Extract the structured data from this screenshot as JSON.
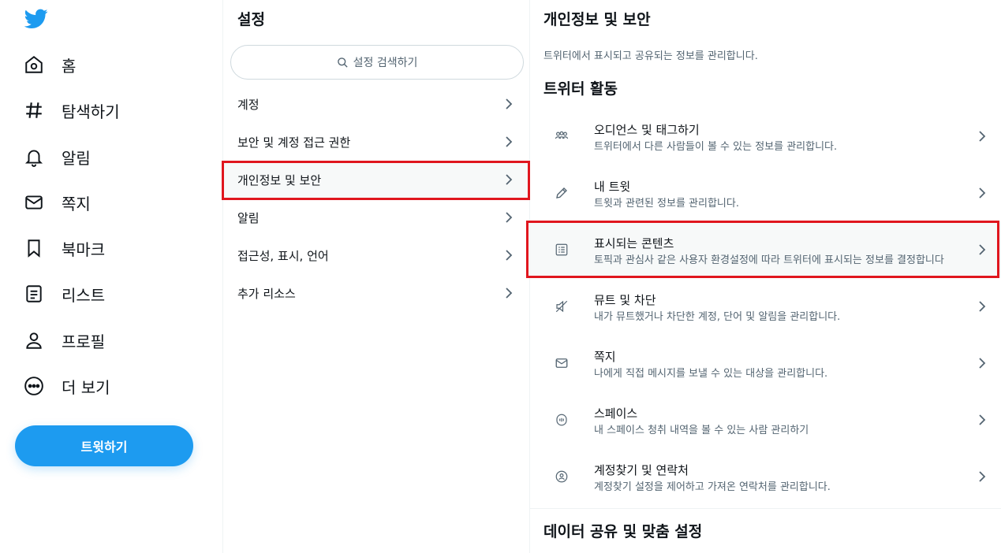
{
  "nav": {
    "items": [
      {
        "label": "홈",
        "icon": "home-icon"
      },
      {
        "label": "탐색하기",
        "icon": "hashtag-icon"
      },
      {
        "label": "알림",
        "icon": "bell-icon"
      },
      {
        "label": "쪽지",
        "icon": "mail-icon"
      },
      {
        "label": "북마크",
        "icon": "bookmark-icon"
      },
      {
        "label": "리스트",
        "icon": "list-icon"
      },
      {
        "label": "프로필",
        "icon": "profile-icon"
      },
      {
        "label": "더 보기",
        "icon": "more-icon"
      }
    ],
    "tweet_button": "트윗하기"
  },
  "settings": {
    "title": "설정",
    "search_placeholder": "설정 검색하기",
    "items": [
      {
        "label": "계정"
      },
      {
        "label": "보안 및 계정 접근 권한"
      },
      {
        "label": "개인정보 및 보안"
      },
      {
        "label": "알림"
      },
      {
        "label": "접근성, 표시, 언어"
      },
      {
        "label": "추가 리소스"
      }
    ]
  },
  "detail": {
    "title": "개인정보 및 보안",
    "subtitle": "트위터에서 표시되고 공유되는 정보를 관리합니다.",
    "section1": "트위터 활동",
    "items": [
      {
        "title": "오디언스 및 태그하기",
        "desc": "트위터에서 다른 사람들이 볼 수 있는 정보를 관리합니다.",
        "icon": "audience-icon"
      },
      {
        "title": "내 트윗",
        "desc": "트윗과 관련된 정보를 관리합니다.",
        "icon": "pencil-icon"
      },
      {
        "title": "표시되는 콘텐츠",
        "desc": "토픽과 관심사 같은 사용자 환경설정에 따라 트위터에 표시되는 정보를 결정합니다",
        "icon": "content-icon"
      },
      {
        "title": "뮤트 및 차단",
        "desc": "내가 뮤트했거나 차단한 계정, 단어 및 알림을 관리합니다.",
        "icon": "mute-icon"
      },
      {
        "title": "쪽지",
        "desc": "나에게 직접 메시지를 보낼 수 있는 대상을 관리합니다.",
        "icon": "mail-icon"
      },
      {
        "title": "스페이스",
        "desc": "내 스페이스 청취 내역을 볼 수 있는 사람 관리하기",
        "icon": "spaces-icon"
      },
      {
        "title": "계정찾기 및 연락처",
        "desc": "계정찾기 설정을 제어하고 가져온 연락처를 관리합니다.",
        "icon": "contacts-icon"
      }
    ],
    "section2": "데이터 공유 및 맞춤 설정"
  },
  "colors": {
    "accent": "#1d9bf0",
    "highlight": "#e0161e",
    "text": "#0f1419",
    "muted": "#536471"
  }
}
